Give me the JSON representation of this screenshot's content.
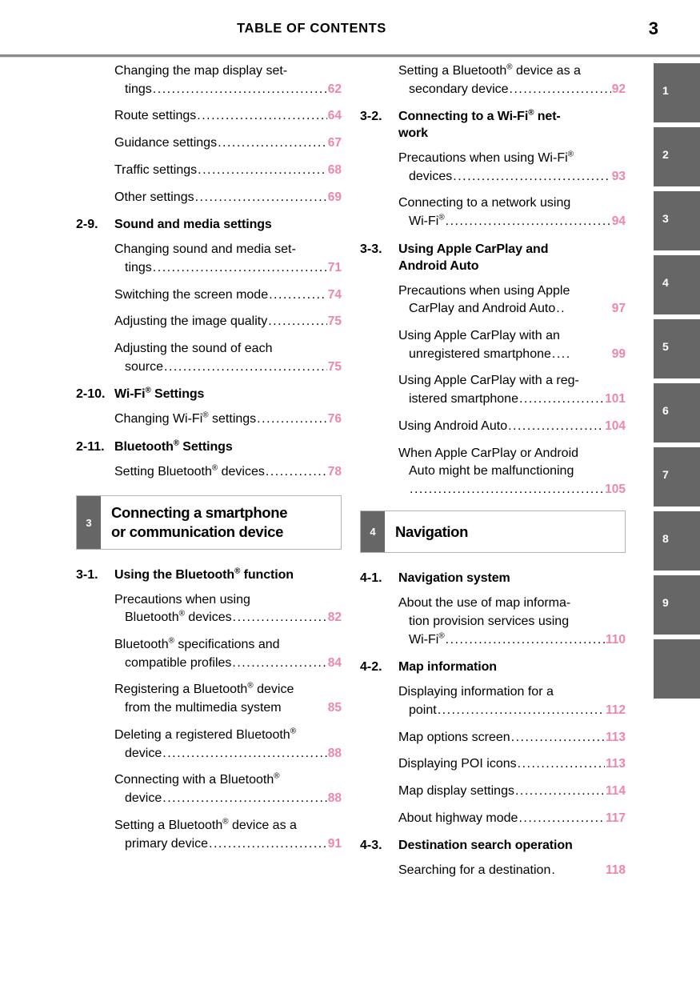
{
  "header": {
    "title": "TABLE OF CONTENTS",
    "page_number": "3"
  },
  "tabs": [
    {
      "label": "1"
    },
    {
      "label": "2"
    },
    {
      "label": "3"
    },
    {
      "label": "4"
    },
    {
      "label": "5"
    },
    {
      "label": "6"
    },
    {
      "label": "7"
    },
    {
      "label": "8"
    },
    {
      "label": "9"
    },
    {
      "label": ""
    }
  ],
  "left_column": {
    "entries_top": [
      {
        "line1": "Changing the map display set-",
        "line2": "tings",
        "page": "62"
      },
      {
        "line1": "Route settings",
        "page": "64"
      },
      {
        "line1": "Guidance settings",
        "page": "67"
      },
      {
        "line1": "Traffic settings",
        "page": "68"
      },
      {
        "line1": "Other settings",
        "page": "69"
      }
    ],
    "section_2_9": {
      "number": "2-9.",
      "title": "Sound and media settings"
    },
    "entries_2_9": [
      {
        "line1": "Changing sound and media set-",
        "line2": "tings",
        "page": "71"
      },
      {
        "line1": "Switching the screen mode",
        "page": "74"
      },
      {
        "line1": "Adjusting the image quality",
        "page": "75"
      },
      {
        "line1": "Adjusting the sound of each",
        "line2": "source",
        "page": "75"
      }
    ],
    "section_2_10": {
      "number": "2-10.",
      "title_pre": "Wi-Fi",
      "title_post": " Settings"
    },
    "entries_2_10": [
      {
        "pre": "Changing Wi-Fi",
        "post": " settings",
        "page": "76"
      }
    ],
    "section_2_11": {
      "number": "2-11.",
      "title_pre": "Bluetooth",
      "title_post": " Settings"
    },
    "entries_2_11": [
      {
        "pre": "Setting Bluetooth",
        "post": " devices",
        "page": "78"
      }
    ],
    "chapter_3": {
      "number": "3",
      "title_line1": "Connecting a smartphone",
      "title_line2": "or communication device"
    },
    "section_3_1": {
      "number": "3-1.",
      "title_pre": "Using the Bluetooth",
      "title_post": " function"
    },
    "entries_3_1": [
      {
        "line1": "Precautions when using",
        "line2_pre": "Bluetooth",
        "line2_post": " devices",
        "page": "82"
      },
      {
        "line1_pre": "Bluetooth",
        "line1_post": " specifications and",
        "line2": "compatible profiles",
        "page": "84"
      },
      {
        "line1_pre": "Registering a Bluetooth",
        "line1_post": " device",
        "line2": "from the multimedia system",
        "page": "85"
      },
      {
        "line1_pre": "Deleting a registered Bluetooth",
        "line1_post": "",
        "line2": "device",
        "page": "88"
      },
      {
        "line1_pre": "Connecting with a Bluetooth",
        "line1_post": "",
        "line2": "device",
        "page": "88"
      },
      {
        "line1_pre": "Setting a Bluetooth",
        "line1_post": " device as a",
        "line2": "primary device",
        "page": "91"
      }
    ]
  },
  "right_column": {
    "entries_top": [
      {
        "line1_pre": "Setting a Bluetooth",
        "line1_post": " device as a",
        "line2": "secondary device",
        "page": "92"
      }
    ],
    "section_3_2": {
      "number": "3-2.",
      "title_pre": "Connecting to a Wi-Fi",
      "title_post": " net-",
      "title_line2": "work"
    },
    "entries_3_2": [
      {
        "line1_pre": "Precautions when using Wi-Fi",
        "line1_post": "",
        "line2": "devices",
        "page": "93"
      },
      {
        "line1": "Connecting to a network using",
        "line2_pre": "Wi-Fi",
        "line2_post": "",
        "page": "94"
      }
    ],
    "section_3_3": {
      "number": "3-3.",
      "title_line1": "Using Apple CarPlay and",
      "title_line2": "Android Auto"
    },
    "entries_3_3": [
      {
        "line1": "Precautions when using Apple",
        "line2": "CarPlay and Android Auto",
        "page": "97"
      },
      {
        "line1": "Using Apple CarPlay with an",
        "line2": "unregistered smartphone",
        "page": "99"
      },
      {
        "line1": "Using Apple CarPlay with a reg-",
        "line2": "istered smartphone",
        "page": "101"
      },
      {
        "line1": "Using Android Auto",
        "page": "104"
      },
      {
        "line1": "When Apple CarPlay or Android",
        "line2": "Auto might be malfunctioning",
        "line3": "",
        "page": "105"
      }
    ],
    "chapter_4": {
      "number": "4",
      "title": "Navigation"
    },
    "section_4_1": {
      "number": "4-1.",
      "title": "Navigation system"
    },
    "entries_4_1": [
      {
        "line1": "About the use of map informa-",
        "line2": "tion provision services using",
        "line3_pre": "Wi-Fi",
        "line3_post": "",
        "page": "110"
      }
    ],
    "section_4_2": {
      "number": "4-2.",
      "title": "Map information"
    },
    "entries_4_2": [
      {
        "line1": "Displaying information for a",
        "line2": "point",
        "page": "112"
      },
      {
        "line1": "Map options screen",
        "page": "113"
      },
      {
        "line1": "Displaying POI icons",
        "page": "113"
      },
      {
        "line1": "Map display settings",
        "page": "114"
      },
      {
        "line1": "About highway mode",
        "page": "117"
      }
    ],
    "section_4_3": {
      "number": "4-3.",
      "title": "Destination search operation"
    },
    "entries_4_3": [
      {
        "line1": "Searching for a destination",
        "page": "118"
      }
    ]
  },
  "colors": {
    "page_number_pink": "#ef85ae",
    "tab_gray": "#666666",
    "rule_gray": "#8a8a8a"
  }
}
